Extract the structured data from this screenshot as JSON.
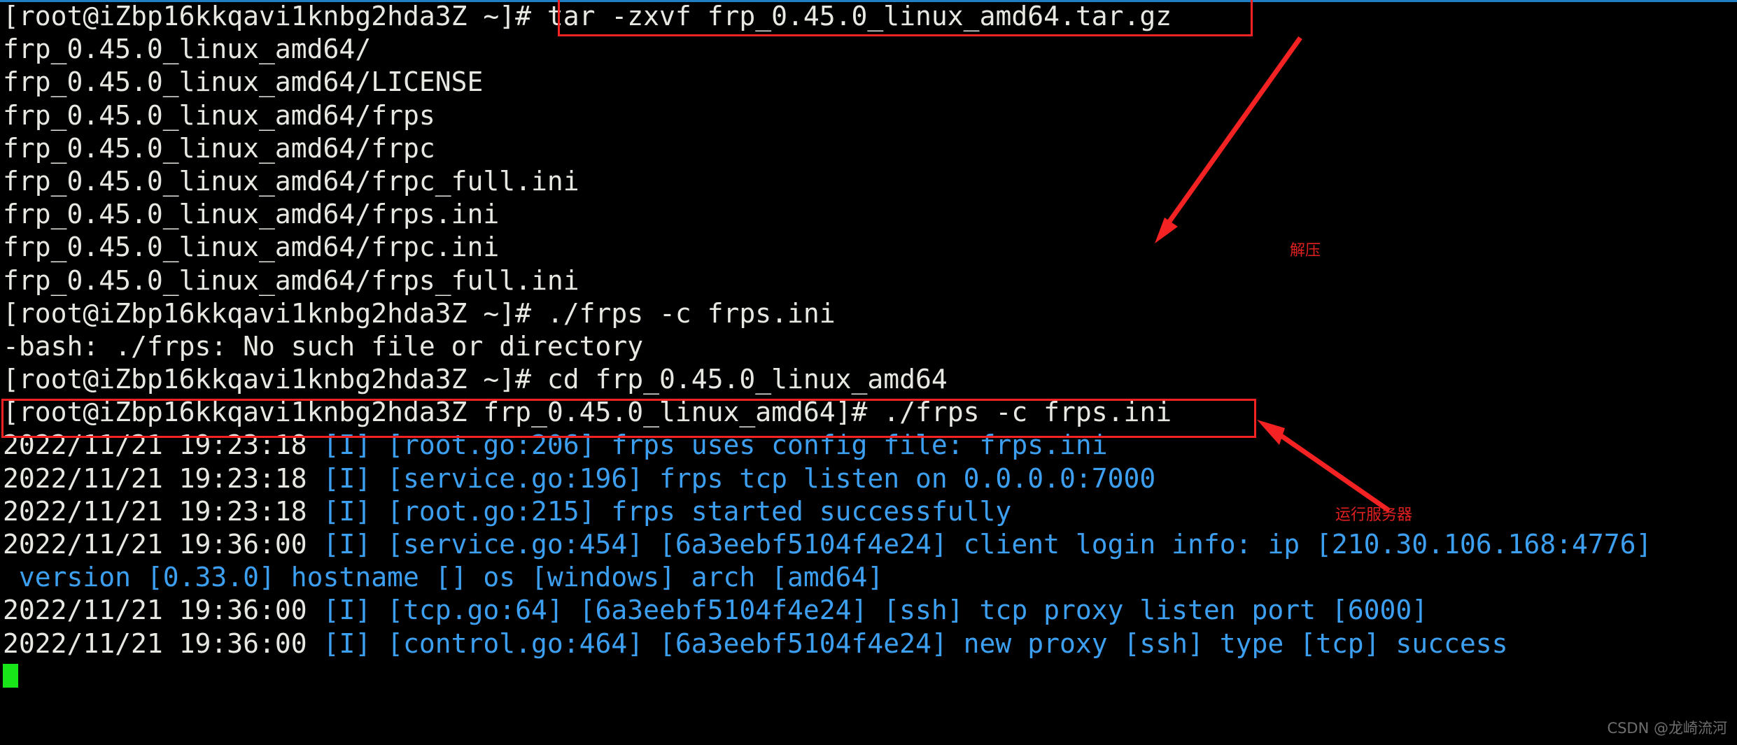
{
  "window": {
    "chrome_accent_color": "#1e7fc4",
    "background_color": "#000000",
    "foreground_color": "#e8e8e3",
    "log_color": "#3d9ff0",
    "cursor_color": "#19e619",
    "annotation_color": "#f42222"
  },
  "shell": {
    "user": "root",
    "host": "iZbp16kkqavi1knbg2hda3Z",
    "prompt_home": "[root@iZbp16kkqavi1knbg2hda3Z ~]# ",
    "prompt_dir": "[root@iZbp16kkqavi1knbg2hda3Z frp_0.45.0_linux_amd64]# "
  },
  "lines": [
    {
      "id": "cmd-tar",
      "kind": "prompt",
      "prompt": "[root@iZbp16kkqavi1knbg2hda3Z ~]# ",
      "command": "tar -zxvf frp_0.45.0_linux_amd64.tar.gz"
    },
    {
      "id": "out-dir",
      "kind": "output",
      "text": "frp_0.45.0_linux_amd64/"
    },
    {
      "id": "out-license",
      "kind": "output",
      "text": "frp_0.45.0_linux_amd64/LICENSE"
    },
    {
      "id": "out-frps",
      "kind": "output",
      "text": "frp_0.45.0_linux_amd64/frps"
    },
    {
      "id": "out-frpc",
      "kind": "output",
      "text": "frp_0.45.0_linux_amd64/frpc"
    },
    {
      "id": "out-frpcfull",
      "kind": "output",
      "text": "frp_0.45.0_linux_amd64/frpc_full.ini"
    },
    {
      "id": "out-frpsini",
      "kind": "output",
      "text": "frp_0.45.0_linux_amd64/frps.ini"
    },
    {
      "id": "out-frpcini",
      "kind": "output",
      "text": "frp_0.45.0_linux_amd64/frpc.ini"
    },
    {
      "id": "out-frpsfull",
      "kind": "output",
      "text": "frp_0.45.0_linux_amd64/frps_full.ini"
    },
    {
      "id": "cmd-frps-fail",
      "kind": "prompt",
      "prompt": "[root@iZbp16kkqavi1knbg2hda3Z ~]# ",
      "command": "./frps -c frps.ini"
    },
    {
      "id": "err-no-file",
      "kind": "output",
      "text": "-bash: ./frps: No such file or directory"
    },
    {
      "id": "cmd-cd",
      "kind": "prompt",
      "prompt": "[root@iZbp16kkqavi1knbg2hda3Z ~]# ",
      "command": "cd frp_0.45.0_linux_amd64"
    },
    {
      "id": "cmd-frps-run",
      "kind": "prompt",
      "prompt": "[root@iZbp16kkqavi1knbg2hda3Z frp_0.45.0_linux_amd64]# ",
      "command": "./frps -c frps.ini"
    },
    {
      "id": "log-config",
      "kind": "log",
      "timestamp": "2022/11/21 19:23:18 ",
      "body": "[I] [root.go:206] frps uses config file: frps.ini"
    },
    {
      "id": "log-tcp-listen",
      "kind": "log",
      "timestamp": "2022/11/21 19:23:18 ",
      "body": "[I] [service.go:196] frps tcp listen on 0.0.0.0:7000"
    },
    {
      "id": "log-started",
      "kind": "log",
      "timestamp": "2022/11/21 19:23:18 ",
      "body": "[I] [root.go:215] frps started successfully"
    },
    {
      "id": "log-login",
      "kind": "log",
      "timestamp": "2022/11/21 19:36:00 ",
      "body": "[I] [service.go:454] [6a3eebf5104f4e24] client login info: ip [210.30.106.168:4776]"
    },
    {
      "id": "log-login-wrap",
      "kind": "log",
      "timestamp": "",
      "body": " version [0.33.0] hostname [] os [windows] arch [amd64]"
    },
    {
      "id": "log-proxy-port",
      "kind": "log",
      "timestamp": "2022/11/21 19:36:00 ",
      "body": "[I] [tcp.go:64] [6a3eebf5104f4e24] [ssh] tcp proxy listen port [6000]"
    },
    {
      "id": "log-new-proxy",
      "kind": "log",
      "timestamp": "2022/11/21 19:36:00 ",
      "body": "[I] [control.go:464] [6a3eebf5104f4e24] new proxy [ssh] type [tcp] success"
    }
  ],
  "annotations": {
    "extract": {
      "label": "解压"
    },
    "run": {
      "label": "运行服务器"
    }
  },
  "watermark": {
    "text": "CSDN @龙崎流河"
  }
}
